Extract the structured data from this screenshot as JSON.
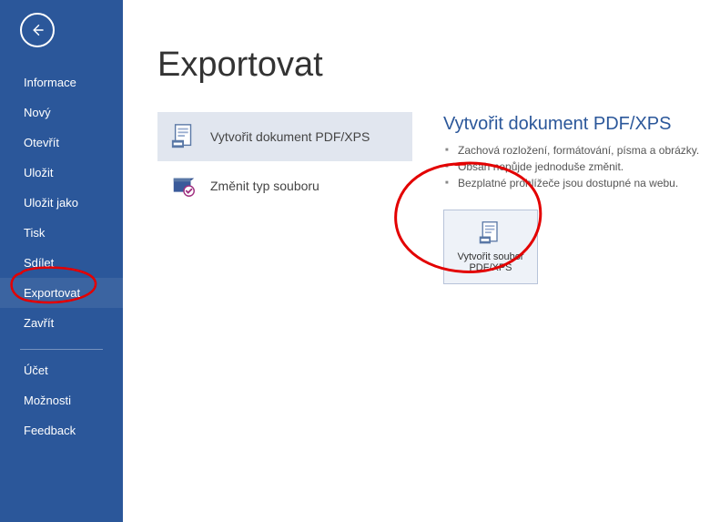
{
  "sidebar": {
    "items": [
      "Informace",
      "Nový",
      "Otevřít",
      "Uložit",
      "Uložit jako",
      "Tisk",
      "Sdílet",
      "Exportovat",
      "Zavřít"
    ],
    "bottomItems": [
      "Účet",
      "Možnosti",
      "Feedback"
    ],
    "selectedIndex": 7
  },
  "page": {
    "title": "Exportovat"
  },
  "options": [
    {
      "label": "Vytvořit dokument PDF/XPS",
      "icon": "pdf-page-icon",
      "selected": true
    },
    {
      "label": "Změnit typ souboru",
      "icon": "change-filetype-icon",
      "selected": false
    }
  ],
  "details": {
    "title": "Vytvořit dokument PDF/XPS",
    "bullets": [
      "Zachová rozložení, formátování, písma a obrázky.",
      "Obsah nepůjde jednoduše změnit.",
      "Bezplatné prohlížeče jsou dostupné na webu."
    ],
    "button": {
      "line1": "Vytvořit soubor",
      "line2": "PDF/XPS"
    }
  }
}
